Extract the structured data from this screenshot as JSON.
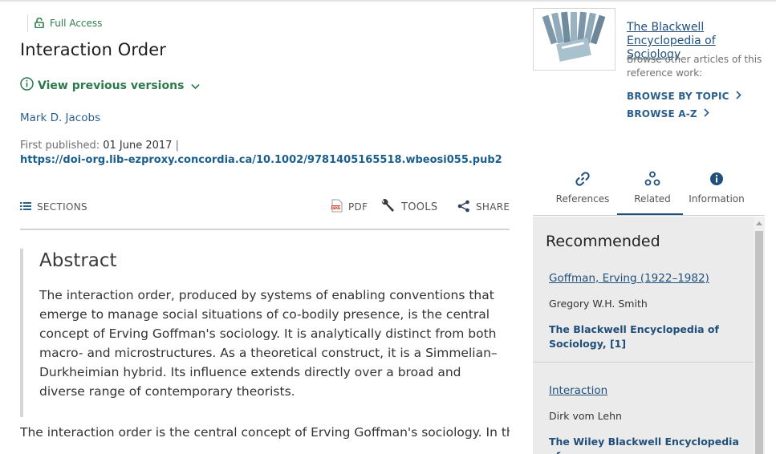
{
  "article": {
    "access_label": "Full Access",
    "title": "Interaction Order",
    "versions_label": "View previous versions",
    "author": "Mark D. Jacobs",
    "first_published_label": "First published:",
    "first_published_date": "01 June 2017",
    "separator": "|",
    "doi": "https://doi-org.lib-ezproxy.concordia.ca/10.1002/9781405165518.wbeosi055.pub2"
  },
  "toolbar": {
    "sections_label": "SECTIONS",
    "pdf_label": "PDF",
    "tools_label": "TOOLS",
    "share_label": "SHARE"
  },
  "abstract": {
    "heading": "Abstract",
    "body": "The interaction order, produced by systems of enabling conventions that emerge to manage social situations of co-bodily presence, is the central concept of Erving Goffman's sociology. It is analytically distinct from both macro- and microstructures. As a theoretical construct, it is a Simmelian–Durkheimian hybrid. Its influence extends directly over a broad and diverse range of contemporary theorists."
  },
  "body_text": "The interaction order is the central concept of Erving Goffman's sociology. In the",
  "sidebar": {
    "book_title": "The Blackwell Encyclopedia of Sociology",
    "book_desc": "Browse other articles of this reference work:",
    "browse_topic": "BROWSE BY TOPIC",
    "browse_az": "BROWSE A-Z",
    "tabs": [
      {
        "label": "References",
        "icon": "link-icon"
      },
      {
        "label": "Related",
        "icon": "related-nodes-icon",
        "active": true
      },
      {
        "label": "Information",
        "icon": "info-icon"
      }
    ],
    "recommended_heading": "Recommended",
    "recommended": [
      {
        "title": "Goffman, Erving (1922–1982)",
        "author": "Gregory W.H. Smith",
        "source": "The Blackwell Encyclopedia of Sociology, [1]"
      },
      {
        "title": "Interaction",
        "author": "Dirk vom Lehn",
        "source": "The Wiley Blackwell Encyclopedia of"
      }
    ]
  },
  "colors": {
    "access_green": "#2d7d4c",
    "link_blue": "#1f4f7a",
    "panel_gray": "#ebebeb",
    "pdf_red": "#d9432f"
  }
}
